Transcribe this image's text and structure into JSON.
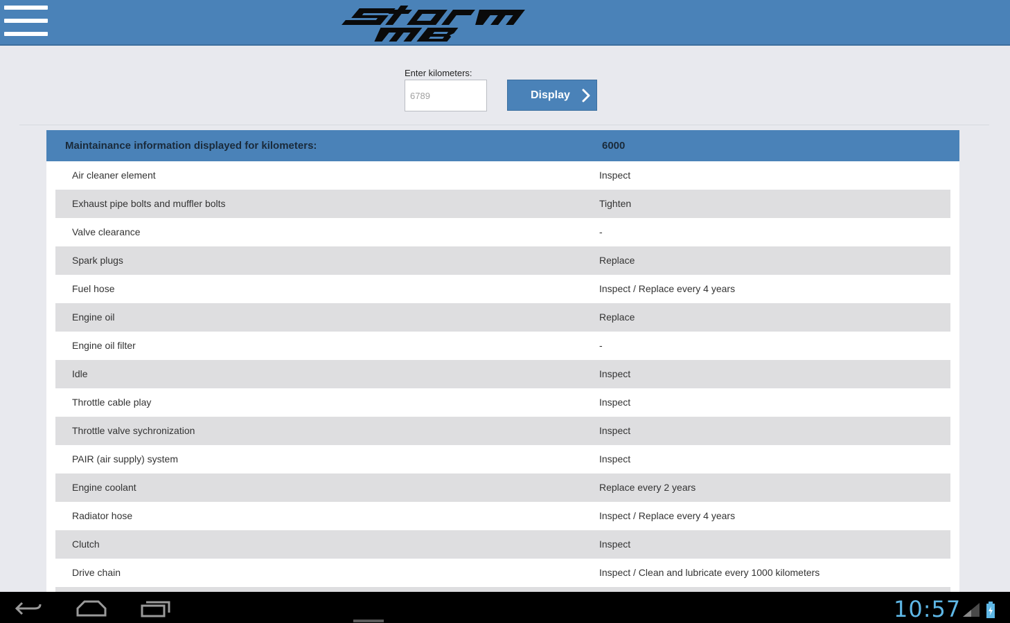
{
  "header": {
    "logo_alt": "Storm MB logo",
    "menu_icon": "hamburger-menu-icon"
  },
  "form": {
    "km_label": "Enter kilometers:",
    "km_placeholder": "6789",
    "display_label": "Display",
    "display_icon": "chevron-right-icon"
  },
  "table": {
    "header_label": "Maintainance information displayed for kilometers:",
    "header_value": "6000",
    "rows": [
      {
        "item": "Air cleaner element",
        "action": "Inspect"
      },
      {
        "item": "Exhaust pipe bolts and muffler bolts",
        "action": "Tighten"
      },
      {
        "item": "Valve clearance",
        "action": "-"
      },
      {
        "item": "Spark plugs",
        "action": "Replace"
      },
      {
        "item": "Fuel hose",
        "action": "Inspect / Replace every 4 years"
      },
      {
        "item": "Engine oil",
        "action": "Replace"
      },
      {
        "item": "Engine oil filter",
        "action": "-"
      },
      {
        "item": "Idle",
        "action": "Inspect"
      },
      {
        "item": "Throttle cable play",
        "action": "Inspect"
      },
      {
        "item": "Throttle valve sychronization",
        "action": "Inspect"
      },
      {
        "item": "PAIR (air supply) system",
        "action": "Inspect"
      },
      {
        "item": "Engine coolant",
        "action": "Replace every 2 years"
      },
      {
        "item": "Radiator hose",
        "action": "Inspect / Replace every 4 years"
      },
      {
        "item": "Clutch",
        "action": "Inspect"
      },
      {
        "item": "Drive chain",
        "action": "Inspect / Clean and lubricate every 1000 kilometers"
      }
    ]
  },
  "system_bar": {
    "clock": "10:57",
    "back_icon": "back-icon",
    "home_icon": "home-icon",
    "recents_icon": "recent-apps-icon"
  },
  "colors": {
    "accent": "#4a82b8",
    "row_alt": "#dedee0",
    "clock": "#5eb7e6"
  }
}
